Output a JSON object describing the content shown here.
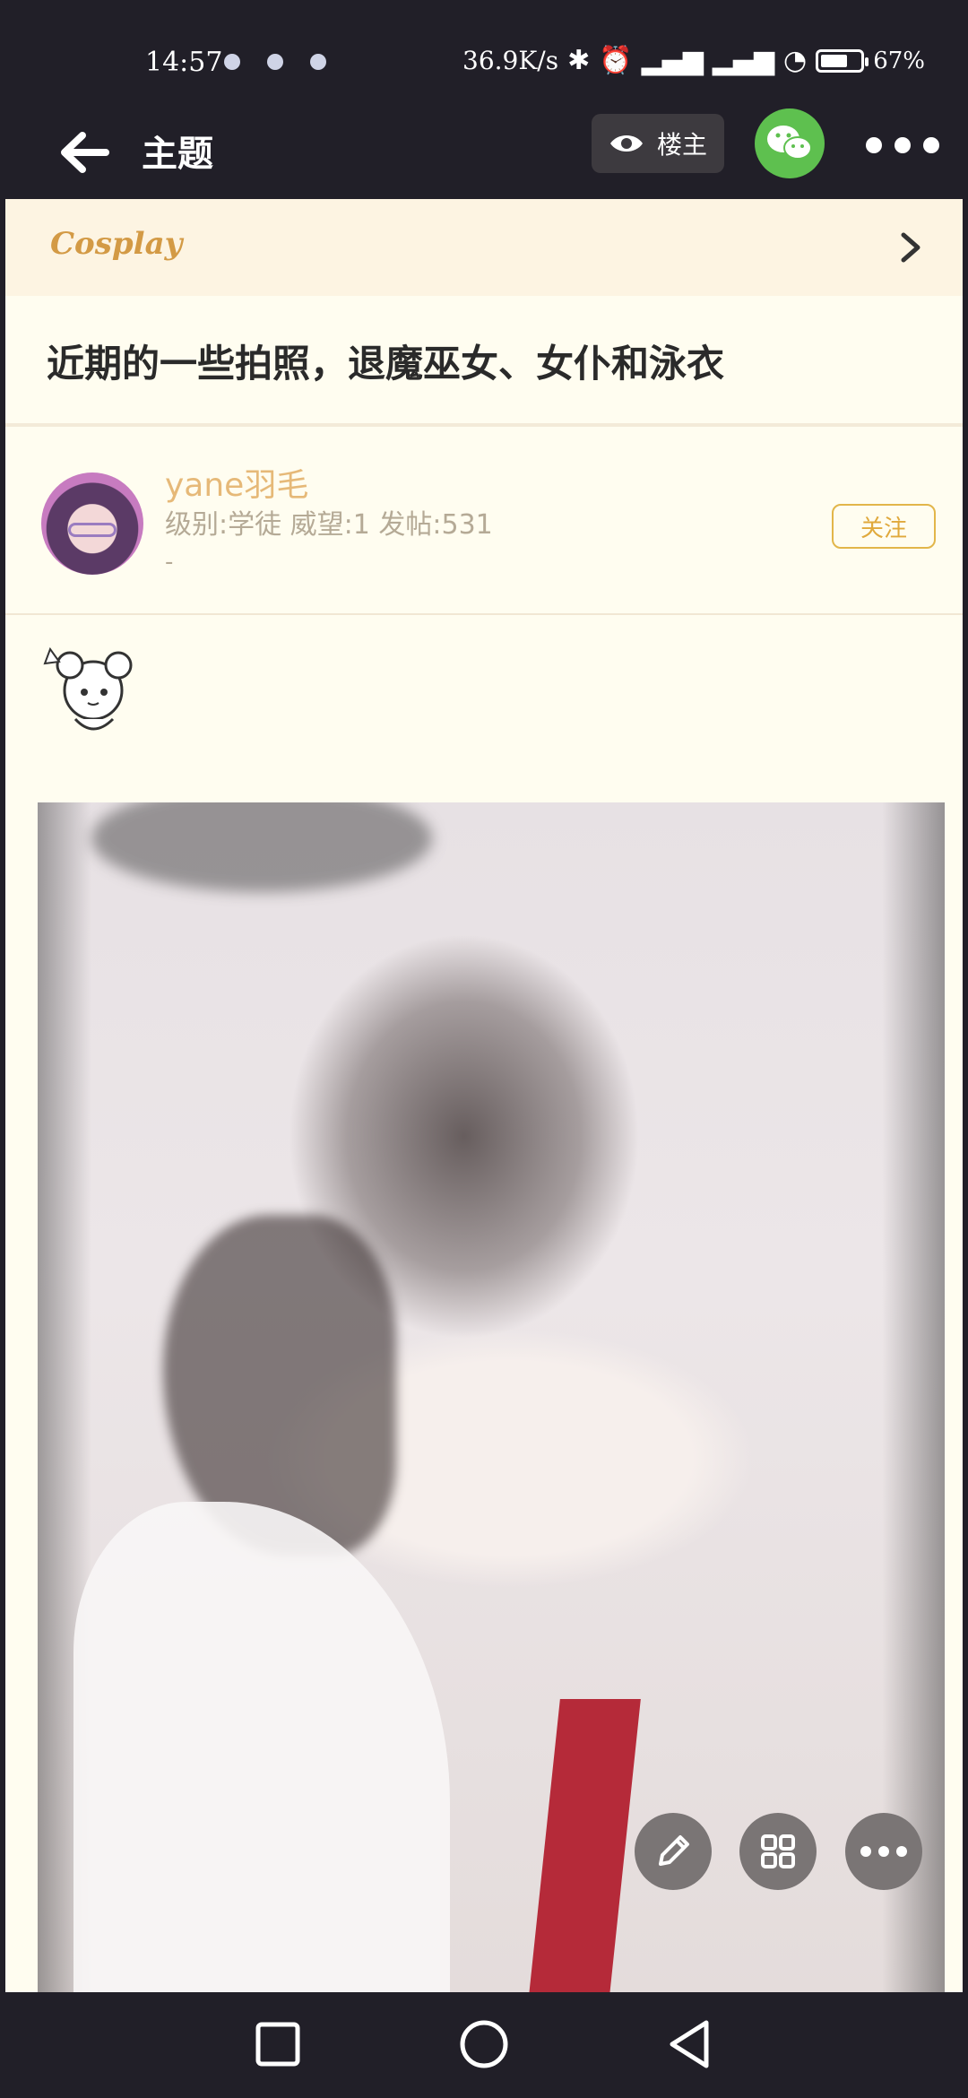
{
  "status_bar": {
    "time": "14:57",
    "net_speed": "36.9K/s",
    "battery": "67%"
  },
  "app_bar": {
    "title": "主题",
    "owner_label": "楼主"
  },
  "forum": {
    "name": "Cosplay"
  },
  "post": {
    "title": "近期的一些拍照，退魔巫女、女仆和泳衣",
    "author": {
      "name": "yane羽毛",
      "info": "级别:学徒 威望:1 发帖:531",
      "signature": "-",
      "follow_label": "关注"
    }
  },
  "colors": {
    "topbar": "#211f28",
    "panel": "#fffdf0",
    "accent": "#e2b64a",
    "wechat": "#5ec04f"
  },
  "icons": {
    "back": "arrow-left",
    "eye": "eye",
    "wechat": "wechat",
    "more": "more-horizontal",
    "chevron": "chevron-right",
    "edit": "pencil",
    "grid": "grid",
    "nav": [
      "square",
      "circle",
      "triangle-left"
    ]
  }
}
